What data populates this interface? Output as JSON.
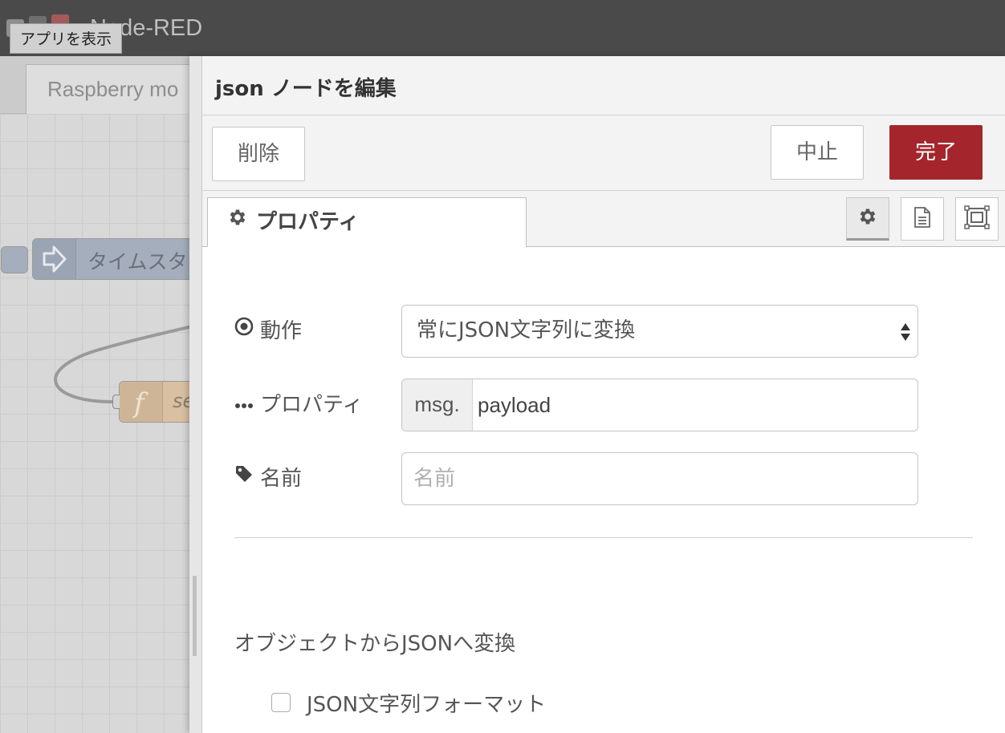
{
  "header": {
    "title": "Node-RED",
    "tooltip": "アプリを表示"
  },
  "workspace": {
    "flow_tab": "Raspberry mo",
    "nodes": [
      {
        "label": "タイムスタ"
      },
      {
        "label": "se"
      }
    ]
  },
  "tray": {
    "title": "json ノードを編集",
    "delete_label": "削除",
    "cancel_label": "中止",
    "done_label": "完了",
    "tab_label": "プロパティ",
    "form": {
      "action_label": "動作",
      "action_value": "常にJSON文字列に変換",
      "property_label": "プロパティ",
      "property_prefix": "msg.",
      "property_value": "payload",
      "name_label": "名前",
      "name_placeholder": "名前",
      "name_value": "",
      "section_heading": "オブジェクトからJSONへ変換",
      "pretty_label": "JSON文字列フォーマット",
      "pretty_checked": false
    }
  },
  "icons": {
    "action": "dot-circle-icon",
    "property": "ellipsis-icon",
    "name": "tag-icon",
    "tab": "gear-icon",
    "tab_buttons": [
      "gear-icon",
      "document-icon",
      "frame-icon"
    ]
  },
  "colors": {
    "header_bg": "#4a4a4a",
    "done_button": "#a4262c",
    "timestamp_node": "#a5aebc",
    "function_node": "#d9c0a3"
  }
}
